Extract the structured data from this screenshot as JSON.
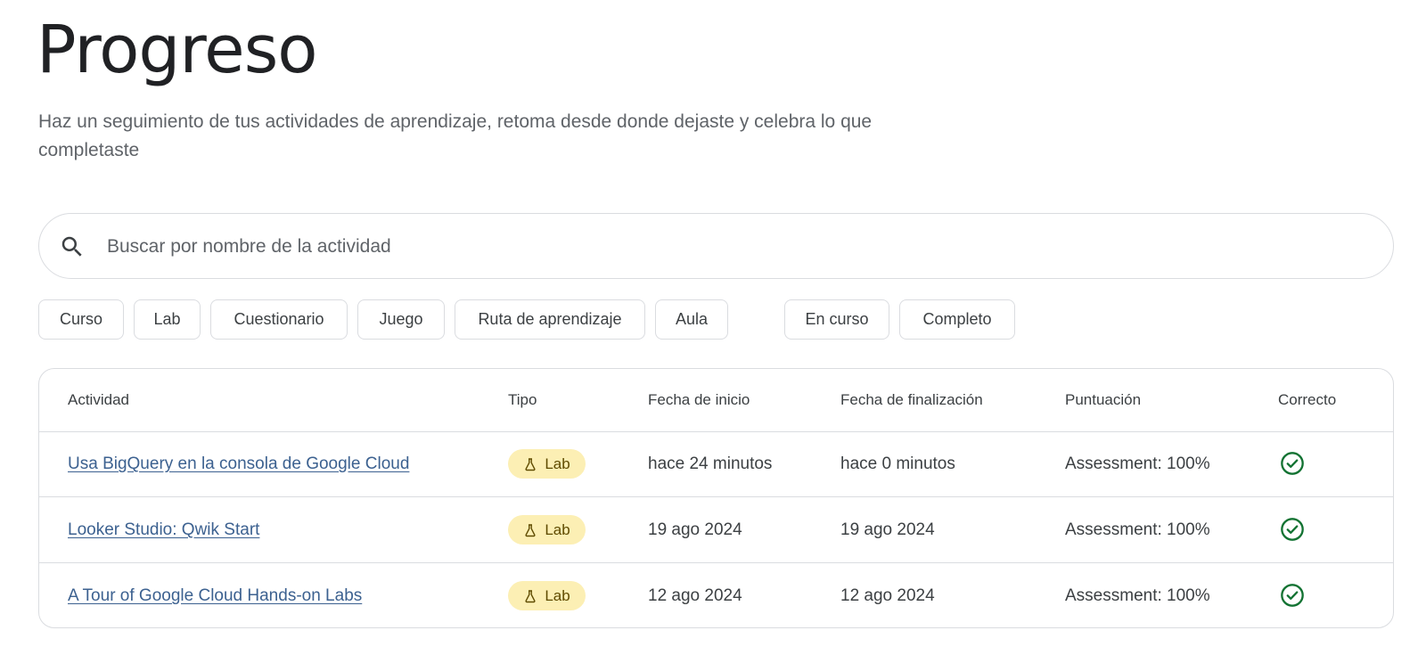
{
  "header": {
    "title": "Progreso",
    "subtitle": "Haz un seguimiento de tus actividades de aprendizaje, retoma desde donde dejaste y celebra lo que completaste"
  },
  "search": {
    "placeholder": "Buscar por nombre de la actividad",
    "value": "",
    "icon": "search-icon"
  },
  "filters": {
    "type_chips": [
      "Curso",
      "Lab",
      "Cuestionario",
      "Juego",
      "Ruta de aprendizaje",
      "Aula"
    ],
    "status_chips": [
      "En curso",
      "Completo"
    ]
  },
  "table": {
    "columns": [
      "Actividad",
      "Tipo",
      "Fecha de inicio",
      "Fecha de finalización",
      "Puntuación",
      "Correcto"
    ],
    "rows": [
      {
        "activity": "Usa BigQuery en la consola de Google Cloud",
        "type": "Lab",
        "start": "hace 24 minutos",
        "end": "hace 0 minutos",
        "score": "Assessment: 100%",
        "correct": true
      },
      {
        "activity": "Looker Studio: Qwik Start",
        "type": "Lab",
        "start": "19 ago 2024",
        "end": "19 ago 2024",
        "score": "Assessment: 100%",
        "correct": true
      },
      {
        "activity": "A Tour of Google Cloud Hands-on Labs",
        "type": "Lab",
        "start": "12 ago 2024",
        "end": "12 ago 2024",
        "score": "Assessment: 100%",
        "correct": true
      }
    ]
  },
  "colors": {
    "link": "#3c6190",
    "badge_bg": "#fcefb4",
    "badge_text": "#5f4b00",
    "check": "#137333",
    "border": "#dadce0"
  }
}
